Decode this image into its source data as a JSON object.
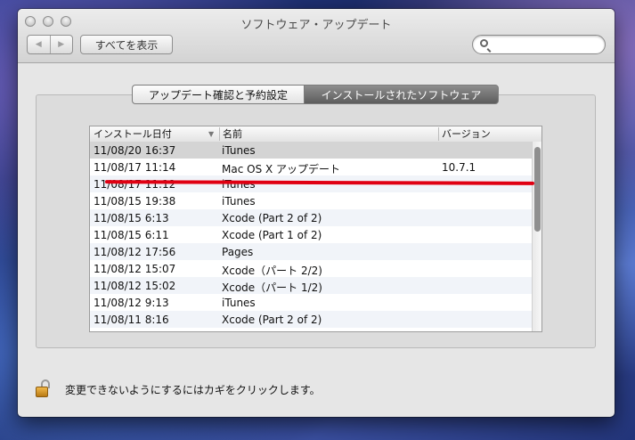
{
  "window": {
    "title": "ソフトウェア・アップデート"
  },
  "toolbar": {
    "back_icon": "◀",
    "forward_icon": "▶",
    "show_all_label": "すべてを表示",
    "search_placeholder": ""
  },
  "tabs": [
    {
      "label": "アップデート確認と予約設定",
      "selected": false
    },
    {
      "label": "インストールされたソフトウェア",
      "selected": true
    }
  ],
  "table": {
    "columns": [
      "インストール日付",
      "名前",
      "バージョン"
    ],
    "sort_indicator": "▼",
    "rows": [
      {
        "date": "11/08/20 16:37",
        "name": "iTunes",
        "version": ""
      },
      {
        "date": "11/08/17 11:14",
        "name": "Mac OS X アップデート",
        "version": "10.7.1"
      },
      {
        "date": "11/08/17 11:12",
        "name": "iTunes",
        "version": ""
      },
      {
        "date": "11/08/15 19:38",
        "name": "iTunes",
        "version": ""
      },
      {
        "date": "11/08/15 6:13",
        "name": "Xcode (Part 2 of 2)",
        "version": ""
      },
      {
        "date": "11/08/15 6:11",
        "name": "Xcode (Part 1 of 2)",
        "version": ""
      },
      {
        "date": "11/08/12 17:56",
        "name": "Pages",
        "version": ""
      },
      {
        "date": "11/08/12 15:07",
        "name": "Xcode（パート 2/2)",
        "version": ""
      },
      {
        "date": "11/08/12 15:02",
        "name": "Xcode（パート 1/2)",
        "version": ""
      },
      {
        "date": "11/08/12 9:13",
        "name": "iTunes",
        "version": ""
      },
      {
        "date": "11/08/11 8:16",
        "name": "Xcode (Part 2 of 2)",
        "version": ""
      }
    ]
  },
  "footer": {
    "lock_text": "変更できないようにするにはカギをクリックします。"
  },
  "colors": {
    "annotation_red": "#e00012",
    "selected_tab": "#6e6e6e"
  }
}
